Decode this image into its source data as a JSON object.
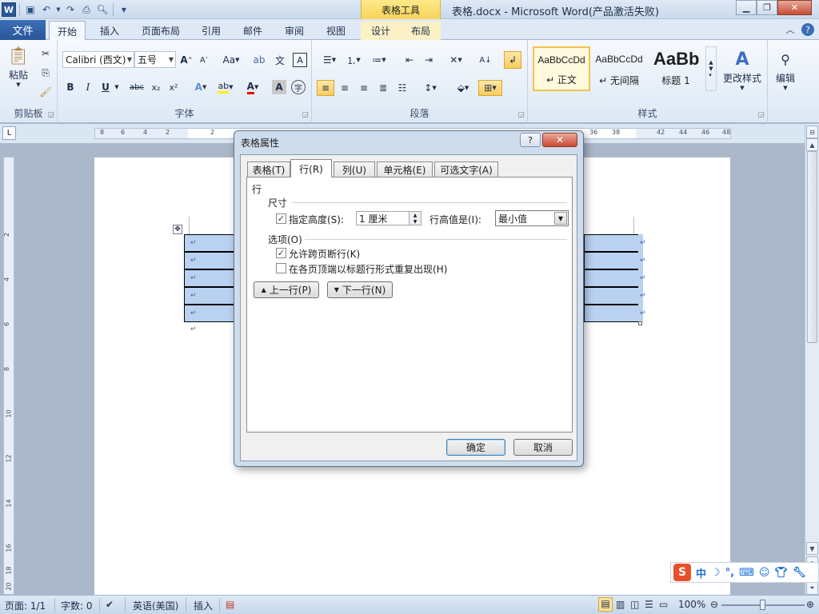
{
  "titlebar": {
    "title": "表格.docx - Microsoft Word(产品激活失败)",
    "context_group": "表格工具",
    "word_icon": "W"
  },
  "tabs": {
    "file": "文件",
    "home": "开始",
    "insert": "插入",
    "layout": "页面布局",
    "references": "引用",
    "mailings": "邮件",
    "review": "审阅",
    "view": "视图",
    "design": "设计",
    "table_layout": "布局"
  },
  "ribbon": {
    "clipboard": {
      "paste": "粘贴",
      "label": "剪贴板"
    },
    "font": {
      "name": "Calibri (西文)",
      "size": "五号",
      "label": "字体",
      "bold": "B",
      "italic": "I",
      "underline": "U",
      "strike": "abc",
      "subscript": "x₂",
      "superscript": "x²",
      "grow": "A",
      "shrink": "A",
      "case": "Aa",
      "color_a": "A",
      "char_shade": "A",
      "char_border": "A"
    },
    "paragraph": {
      "label": "段落"
    },
    "styles": {
      "label": "样式",
      "items": [
        {
          "sample": "AaBbCcDd",
          "name": "↵ 正文"
        },
        {
          "sample": "AaBbCcDd",
          "name": "↵ 无间隔"
        },
        {
          "sample": "AaBb",
          "name": "标题 1"
        }
      ],
      "change": "更改样式"
    },
    "editing": {
      "label": "编辑"
    }
  },
  "ruler": {
    "h_ticks": [
      "8",
      "6",
      "4",
      "2",
      "2",
      "36",
      "38",
      "42",
      "44",
      "46",
      "48"
    ],
    "v_ticks": [
      "2",
      "4",
      "6",
      "8",
      "10",
      "12",
      "14",
      "16",
      "18",
      "20"
    ]
  },
  "dialog": {
    "title": "表格属性",
    "help": "?",
    "close": "✕",
    "tabs": [
      "表格(T)",
      "行(R)",
      "列(U)",
      "单元格(E)",
      "可选文字(A)"
    ],
    "section": "行",
    "size_label": "尺寸",
    "specify_height": "指定高度(S):",
    "height_value": "1 厘米",
    "row_height_is": "行高值是(I):",
    "row_height_mode": "最小值",
    "options_label": "选项(O)",
    "allow_break": "允许跨页断行(K)",
    "repeat_header": "在各页顶端以标题行形式重复出现(H)",
    "prev_row": "上一行(P)",
    "next_row": "下一行(N)",
    "ok": "确定",
    "cancel": "取消"
  },
  "status": {
    "page": "页面: 1/1",
    "words": "字数: 0",
    "language": "英语(美国)",
    "mode": "插入",
    "zoom": "100%"
  },
  "ime": {
    "logo": "S",
    "lang": "中"
  }
}
